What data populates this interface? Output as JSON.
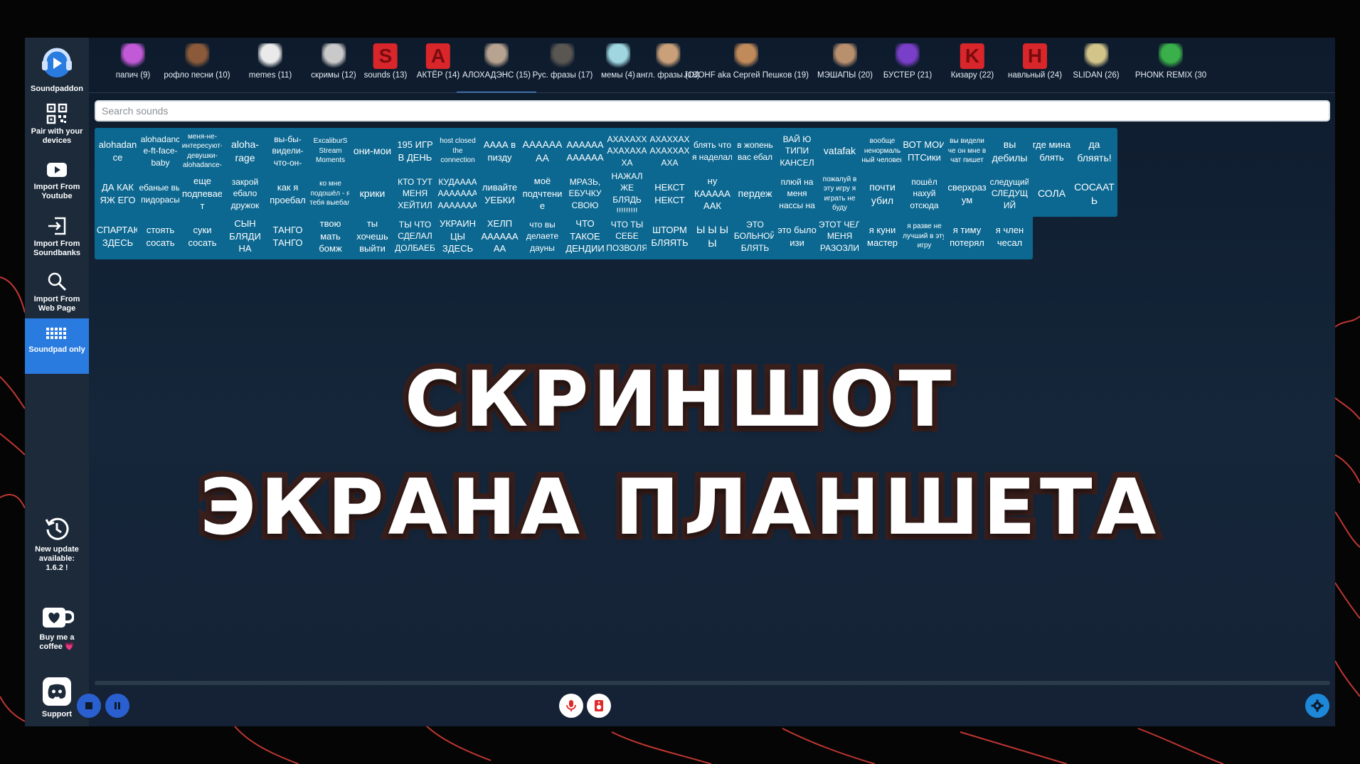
{
  "colors": {
    "pad": "#0c6891",
    "accent": "#2a7be0",
    "sidebar": "#1c2a3a",
    "background": "#0d1b2c"
  },
  "sidebar": {
    "brand": "Soundpaddon",
    "pair": "Pair with your devices",
    "youtube": "Import From Youtube",
    "soundbanks": "Import From Soundbanks",
    "webpage": "Import From Web Page",
    "soundpad_only": "Soundpad only",
    "update": "New update available: 1.6.2 !",
    "coffee": "Buy me a coffee 💗",
    "support": "Support"
  },
  "tabs": [
    {
      "label": "папич (9)",
      "icon": "avatar-icon",
      "color": "#c25ad8"
    },
    {
      "label": "рофло песни (10)",
      "icon": "avatar-icon",
      "color": "#8a5a3a"
    },
    {
      "label": "memes (11)",
      "icon": "troll-face-icon",
      "color": "#eaeaea"
    },
    {
      "label": "скримы (12)",
      "icon": "figure-icon",
      "color": "#c9c9c9"
    },
    {
      "label": "sounds (13)",
      "icon": "letter-s-icon",
      "color": "#d8262a",
      "letter": "S"
    },
    {
      "label": "АКТЁР (14)",
      "icon": "letter-a-icon",
      "color": "#d8262a",
      "letter": "A"
    },
    {
      "label": "АЛОХАДЭНС (15)",
      "icon": "photo-icon",
      "color": "#b7a38f"
    },
    {
      "label": "Рус. фразы (17)",
      "icon": "avatar-icon",
      "color": "#5a5652"
    },
    {
      "label": "мемы (4)",
      "icon": "mask-icon",
      "color": "#9fd6e0"
    },
    {
      "label": "англ. фразы (18)",
      "icon": "figure-icon",
      "color": "#c9a07a"
    },
    {
      "label": "JOJOHF aka Сергей Пешков (19)",
      "icon": "avatar-icon",
      "color": "#c08a5a"
    },
    {
      "label": "МЭШАПЫ (20)",
      "icon": "avatar-icon",
      "color": "#b8906e"
    },
    {
      "label": "БУСТЕР (21)",
      "icon": "avatar-icon",
      "color": "#7a3fc8"
    },
    {
      "label": "Кизару (22)",
      "icon": "letter-k-icon",
      "color": "#d8262a",
      "letter": "K"
    },
    {
      "label": "навльный (24)",
      "icon": "letter-h-icon",
      "color": "#d8262a",
      "letter": "H"
    },
    {
      "label": "SLIDAN (26)",
      "icon": "photo-icon",
      "color": "#d3c48a"
    },
    {
      "label": "PHONK REMIX (30",
      "icon": "frog-icon",
      "color": "#3ab04a"
    }
  ],
  "active_tab": 6,
  "search": {
    "placeholder": "Search sounds"
  },
  "pads": [
    [
      "alohadan ce",
      "alohadanc e-ft-face-baby",
      "меня-не-интересуют-девушки-alohadance-",
      "aloha-rage",
      "вы-бы-видели-что-он-",
      "ExcaliburS Stream Moments",
      "они-мои",
      "195 ИГР В ДЕНЬ",
      "host closed the connection",
      "АААА в пизду",
      "АААААА АА",
      "АААААА АААААА",
      "АХАХАХХ АХАХАХА ХА",
      "АХАХХАХ АХАХХАХ АХА",
      "блять что я наделал",
      "в жопень вас ебал",
      "ВАЙ Ю ТИПИ КАНСЕЛ",
      "vatafak",
      "вообще ненормаль ный человек",
      "ВОТ МОИ ПТСики",
      "вы видели че он мне в чат пишет",
      "вы дебилы",
      "где мина блять",
      "да бляять!"
    ],
    [
      "ДА КАК ЯЖ ЕГО",
      "ебаные вы пидорасы",
      "еще подпевае т",
      "закрой ебало дружок",
      "как я проебал",
      "ко мне подошёл - я тебя выебал",
      "крики",
      "КТО ТУТ МЕНЯ ХЕЙТИЛ",
      "КУДАААА ААААААА ААААААА",
      "ливайте УЕБКИ",
      "моё подчтени е",
      "МРАЗЬ, ЕБУЧКУ СВОЮ",
      "НАЖАЛ ЖЕ БЛЯДЬ !!!!!!!!!",
      "НЕКСТ НЕКСТ",
      "ну КААААА ААК",
      "пердеж",
      "плюй на меня нассы на",
      "пожалуй в эту игру я играть не буду",
      "почти убил",
      "пошёл нахуй отсюда",
      "сверхраз ум",
      "следущий СЛЕДУЩ ИЙ",
      "СОЛА",
      "СОСААТ Ь"
    ],
    [
      "СПАРТАК ЗДЕСЬ",
      "стоять сосать",
      "суки сосать",
      "СЫН БЛЯДИ НА",
      "ТАНГО ТАНГО",
      "твою мать бомж",
      "ты хочешь выйти",
      "ТЫ ЧТО СДЕЛАЛ ДОЛБАЕБ",
      "УКРАИН ЦЫ ЗДЕСЬ",
      "ХЕЛП АААААА АА",
      "что вы делаете дауны",
      "ЧТО ТАКОЕ ДЕНДИИ",
      "ЧТО ТЫ СЕБЕ ПОЗВОЛЯ",
      "ШТОРМ БЛЯЯТЬ",
      "Ы Ы Ы Ы",
      "ЭТО БОЛЬНОЙ БЛЯТЬ",
      "это было изи",
      "ЭТОТ ЧЕЛ МЕНЯ РАЗОЗЛИ",
      "я куни мастер",
      "я разве не лучший в эту игру",
      "я тиму потерял",
      "я член чесал"
    ]
  ],
  "overlay": {
    "line1": "СКРИНШОТ",
    "line2": "ЭКРАНА ПЛАНШЕТА"
  },
  "controls": {
    "stop_icon": "stop-icon",
    "pause_icon": "pause-icon",
    "mic_icon": "microphone-icon",
    "speaker_icon": "speaker-icon",
    "settings_icon": "gear-icon"
  }
}
